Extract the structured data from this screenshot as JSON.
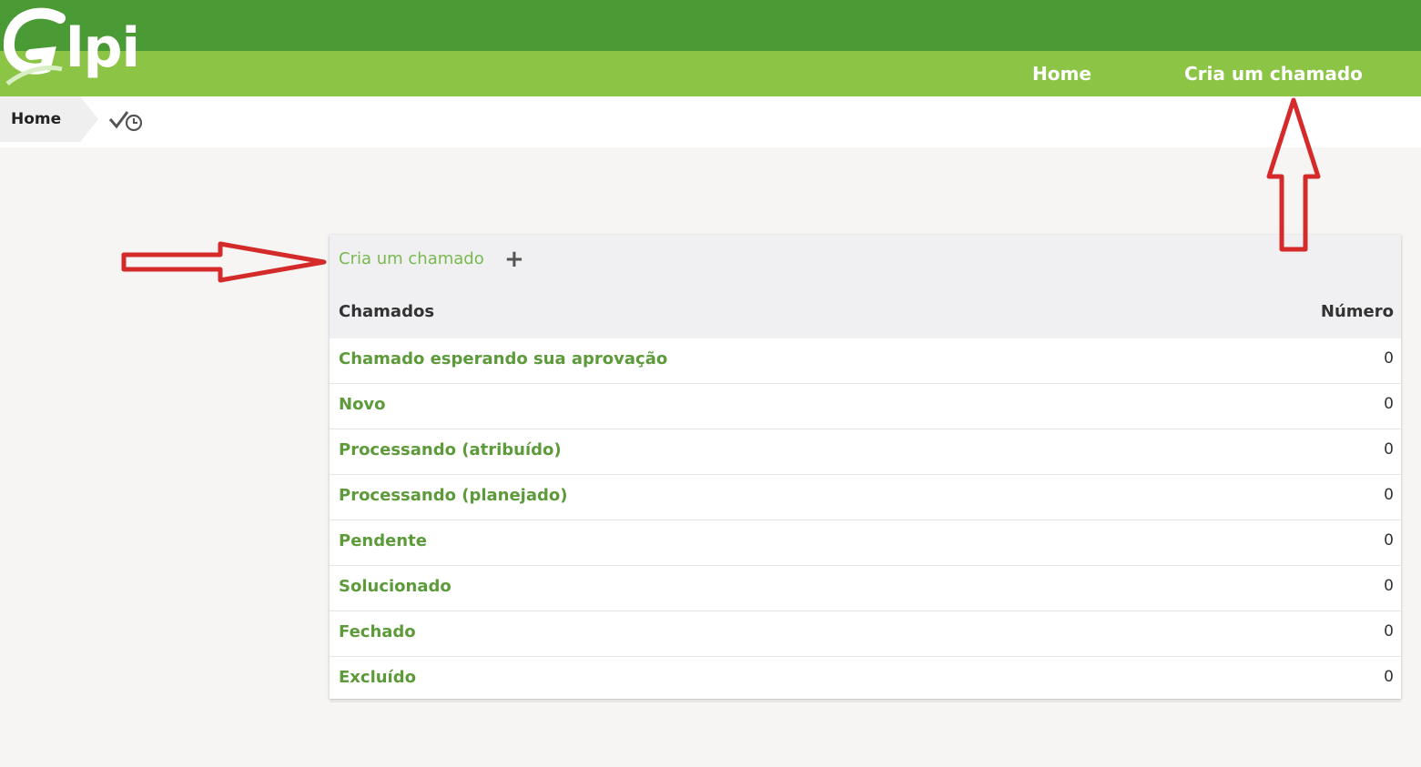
{
  "logo": {
    "text": "lpi"
  },
  "nav": {
    "home": "Home",
    "create_ticket": "Cria um chamado"
  },
  "breadcrumb": {
    "home": "Home",
    "icon": "check-clock-icon"
  },
  "panel": {
    "create_link": "Cria um chamado",
    "create_plus": "+",
    "header_tickets": "Chamados",
    "header_number": "Número",
    "rows": [
      {
        "label": "Chamado esperando sua aprovação",
        "value": "0"
      },
      {
        "label": "Novo",
        "value": "0"
      },
      {
        "label": "Processando (atribuído)",
        "value": "0"
      },
      {
        "label": "Processando (planejado)",
        "value": "0"
      },
      {
        "label": "Pendente",
        "value": "0"
      },
      {
        "label": "Solucionado",
        "value": "0"
      },
      {
        "label": "Fechado",
        "value": "0"
      },
      {
        "label": "Excluído",
        "value": "0"
      }
    ]
  },
  "colors": {
    "header_dark": "#4a9a36",
    "header_light": "#8cc546",
    "link_green": "#5c9a3a",
    "annotation_red": "#d42a2a"
  }
}
